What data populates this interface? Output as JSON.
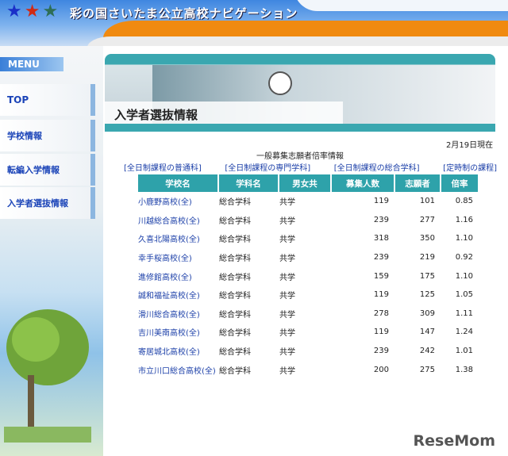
{
  "header": {
    "title": "彩の国さいたま公立高校ナビゲーション"
  },
  "sidebar": {
    "menu_title": "MENU",
    "items": [
      {
        "label": "TOP"
      },
      {
        "label": "学校情報"
      },
      {
        "label": "転編入学情報"
      },
      {
        "label": "入学者選抜情報"
      }
    ]
  },
  "banner": {
    "title": "入学者選抜情報"
  },
  "main": {
    "date": "2月19日現在",
    "caption": "一般募集志願者倍率情報",
    "links": [
      "[全日制課程の普通科]",
      "[全日制課程の専門学科]",
      "[全日制課程の総合学科]",
      "[定時制の課程]"
    ],
    "table": {
      "headers": [
        "学校名",
        "学科名",
        "男女共",
        "募集人数",
        "志願者",
        "倍率"
      ],
      "rows": [
        [
          "小鹿野高校(全)",
          "総合学科",
          "共学",
          "119",
          "101",
          "0.85"
        ],
        [
          "川越総合高校(全)",
          "総合学科",
          "共学",
          "239",
          "277",
          "1.16"
        ],
        [
          "久喜北陽高校(全)",
          "総合学科",
          "共学",
          "318",
          "350",
          "1.10"
        ],
        [
          "幸手桜高校(全)",
          "総合学科",
          "共学",
          "239",
          "219",
          "0.92"
        ],
        [
          "進修館高校(全)",
          "総合学科",
          "共学",
          "159",
          "175",
          "1.10"
        ],
        [
          "誠和福祉高校(全)",
          "総合学科",
          "共学",
          "119",
          "125",
          "1.05"
        ],
        [
          "滑川総合高校(全)",
          "総合学科",
          "共学",
          "278",
          "309",
          "1.11"
        ],
        [
          "吉川美南高校(全)",
          "総合学科",
          "共学",
          "119",
          "147",
          "1.24"
        ],
        [
          "寄居城北高校(全)",
          "総合学科",
          "共学",
          "239",
          "242",
          "1.01"
        ],
        [
          "市立川口総合高校(全)",
          "総合学科",
          "共学",
          "200",
          "275",
          "1.38"
        ]
      ]
    }
  },
  "watermark": "ReseMom"
}
